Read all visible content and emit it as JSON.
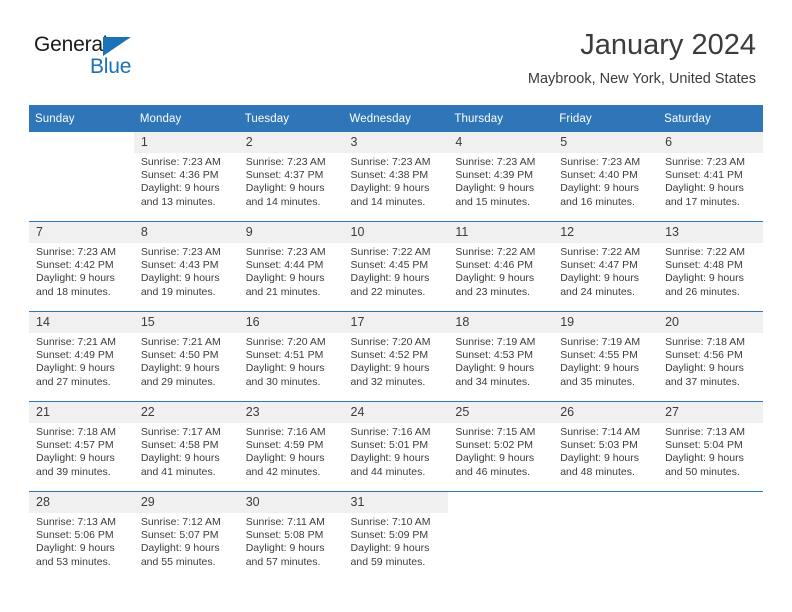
{
  "brand": {
    "name_part1": "General",
    "name_part2": "Blue",
    "triangle_icon": "triangle-icon",
    "accent_color": "#1a72b8"
  },
  "header": {
    "title": "January 2024",
    "location": "Maybrook, New York, United States",
    "header_bg_color": "#2e76b8"
  },
  "calendar": {
    "weekday_headers": [
      "Sunday",
      "Monday",
      "Tuesday",
      "Wednesday",
      "Thursday",
      "Friday",
      "Saturday"
    ],
    "weeks": [
      [
        {
          "day": "",
          "sunrise": "",
          "sunset": "",
          "daylight1": "",
          "daylight2": ""
        },
        {
          "day": "1",
          "sunrise": "Sunrise: 7:23 AM",
          "sunset": "Sunset: 4:36 PM",
          "daylight1": "Daylight: 9 hours",
          "daylight2": "and 13 minutes."
        },
        {
          "day": "2",
          "sunrise": "Sunrise: 7:23 AM",
          "sunset": "Sunset: 4:37 PM",
          "daylight1": "Daylight: 9 hours",
          "daylight2": "and 14 minutes."
        },
        {
          "day": "3",
          "sunrise": "Sunrise: 7:23 AM",
          "sunset": "Sunset: 4:38 PM",
          "daylight1": "Daylight: 9 hours",
          "daylight2": "and 14 minutes."
        },
        {
          "day": "4",
          "sunrise": "Sunrise: 7:23 AM",
          "sunset": "Sunset: 4:39 PM",
          "daylight1": "Daylight: 9 hours",
          "daylight2": "and 15 minutes."
        },
        {
          "day": "5",
          "sunrise": "Sunrise: 7:23 AM",
          "sunset": "Sunset: 4:40 PM",
          "daylight1": "Daylight: 9 hours",
          "daylight2": "and 16 minutes."
        },
        {
          "day": "6",
          "sunrise": "Sunrise: 7:23 AM",
          "sunset": "Sunset: 4:41 PM",
          "daylight1": "Daylight: 9 hours",
          "daylight2": "and 17 minutes."
        }
      ],
      [
        {
          "day": "7",
          "sunrise": "Sunrise: 7:23 AM",
          "sunset": "Sunset: 4:42 PM",
          "daylight1": "Daylight: 9 hours",
          "daylight2": "and 18 minutes."
        },
        {
          "day": "8",
          "sunrise": "Sunrise: 7:23 AM",
          "sunset": "Sunset: 4:43 PM",
          "daylight1": "Daylight: 9 hours",
          "daylight2": "and 19 minutes."
        },
        {
          "day": "9",
          "sunrise": "Sunrise: 7:23 AM",
          "sunset": "Sunset: 4:44 PM",
          "daylight1": "Daylight: 9 hours",
          "daylight2": "and 21 minutes."
        },
        {
          "day": "10",
          "sunrise": "Sunrise: 7:22 AM",
          "sunset": "Sunset: 4:45 PM",
          "daylight1": "Daylight: 9 hours",
          "daylight2": "and 22 minutes."
        },
        {
          "day": "11",
          "sunrise": "Sunrise: 7:22 AM",
          "sunset": "Sunset: 4:46 PM",
          "daylight1": "Daylight: 9 hours",
          "daylight2": "and 23 minutes."
        },
        {
          "day": "12",
          "sunrise": "Sunrise: 7:22 AM",
          "sunset": "Sunset: 4:47 PM",
          "daylight1": "Daylight: 9 hours",
          "daylight2": "and 24 minutes."
        },
        {
          "day": "13",
          "sunrise": "Sunrise: 7:22 AM",
          "sunset": "Sunset: 4:48 PM",
          "daylight1": "Daylight: 9 hours",
          "daylight2": "and 26 minutes."
        }
      ],
      [
        {
          "day": "14",
          "sunrise": "Sunrise: 7:21 AM",
          "sunset": "Sunset: 4:49 PM",
          "daylight1": "Daylight: 9 hours",
          "daylight2": "and 27 minutes."
        },
        {
          "day": "15",
          "sunrise": "Sunrise: 7:21 AM",
          "sunset": "Sunset: 4:50 PM",
          "daylight1": "Daylight: 9 hours",
          "daylight2": "and 29 minutes."
        },
        {
          "day": "16",
          "sunrise": "Sunrise: 7:20 AM",
          "sunset": "Sunset: 4:51 PM",
          "daylight1": "Daylight: 9 hours",
          "daylight2": "and 30 minutes."
        },
        {
          "day": "17",
          "sunrise": "Sunrise: 7:20 AM",
          "sunset": "Sunset: 4:52 PM",
          "daylight1": "Daylight: 9 hours",
          "daylight2": "and 32 minutes."
        },
        {
          "day": "18",
          "sunrise": "Sunrise: 7:19 AM",
          "sunset": "Sunset: 4:53 PM",
          "daylight1": "Daylight: 9 hours",
          "daylight2": "and 34 minutes."
        },
        {
          "day": "19",
          "sunrise": "Sunrise: 7:19 AM",
          "sunset": "Sunset: 4:55 PM",
          "daylight1": "Daylight: 9 hours",
          "daylight2": "and 35 minutes."
        },
        {
          "day": "20",
          "sunrise": "Sunrise: 7:18 AM",
          "sunset": "Sunset: 4:56 PM",
          "daylight1": "Daylight: 9 hours",
          "daylight2": "and 37 minutes."
        }
      ],
      [
        {
          "day": "21",
          "sunrise": "Sunrise: 7:18 AM",
          "sunset": "Sunset: 4:57 PM",
          "daylight1": "Daylight: 9 hours",
          "daylight2": "and 39 minutes."
        },
        {
          "day": "22",
          "sunrise": "Sunrise: 7:17 AM",
          "sunset": "Sunset: 4:58 PM",
          "daylight1": "Daylight: 9 hours",
          "daylight2": "and 41 minutes."
        },
        {
          "day": "23",
          "sunrise": "Sunrise: 7:16 AM",
          "sunset": "Sunset: 4:59 PM",
          "daylight1": "Daylight: 9 hours",
          "daylight2": "and 42 minutes."
        },
        {
          "day": "24",
          "sunrise": "Sunrise: 7:16 AM",
          "sunset": "Sunset: 5:01 PM",
          "daylight1": "Daylight: 9 hours",
          "daylight2": "and 44 minutes."
        },
        {
          "day": "25",
          "sunrise": "Sunrise: 7:15 AM",
          "sunset": "Sunset: 5:02 PM",
          "daylight1": "Daylight: 9 hours",
          "daylight2": "and 46 minutes."
        },
        {
          "day": "26",
          "sunrise": "Sunrise: 7:14 AM",
          "sunset": "Sunset: 5:03 PM",
          "daylight1": "Daylight: 9 hours",
          "daylight2": "and 48 minutes."
        },
        {
          "day": "27",
          "sunrise": "Sunrise: 7:13 AM",
          "sunset": "Sunset: 5:04 PM",
          "daylight1": "Daylight: 9 hours",
          "daylight2": "and 50 minutes."
        }
      ],
      [
        {
          "day": "28",
          "sunrise": "Sunrise: 7:13 AM",
          "sunset": "Sunset: 5:06 PM",
          "daylight1": "Daylight: 9 hours",
          "daylight2": "and 53 minutes."
        },
        {
          "day": "29",
          "sunrise": "Sunrise: 7:12 AM",
          "sunset": "Sunset: 5:07 PM",
          "daylight1": "Daylight: 9 hours",
          "daylight2": "and 55 minutes."
        },
        {
          "day": "30",
          "sunrise": "Sunrise: 7:11 AM",
          "sunset": "Sunset: 5:08 PM",
          "daylight1": "Daylight: 9 hours",
          "daylight2": "and 57 minutes."
        },
        {
          "day": "31",
          "sunrise": "Sunrise: 7:10 AM",
          "sunset": "Sunset: 5:09 PM",
          "daylight1": "Daylight: 9 hours",
          "daylight2": "and 59 minutes."
        },
        {
          "day": "",
          "sunrise": "",
          "sunset": "",
          "daylight1": "",
          "daylight2": ""
        },
        {
          "day": "",
          "sunrise": "",
          "sunset": "",
          "daylight1": "",
          "daylight2": ""
        },
        {
          "day": "",
          "sunrise": "",
          "sunset": "",
          "daylight1": "",
          "daylight2": ""
        }
      ]
    ]
  }
}
